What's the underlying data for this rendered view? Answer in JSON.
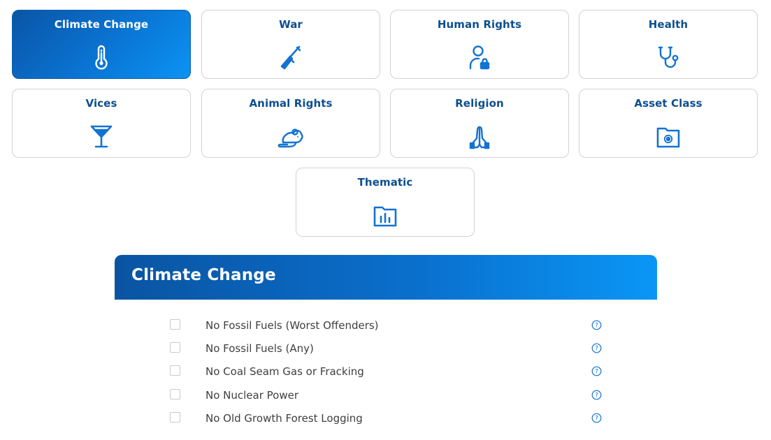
{
  "categories": [
    {
      "label": "Climate Change",
      "icon": "thermometer-icon",
      "active": true
    },
    {
      "label": "War",
      "icon": "rifle-icon",
      "active": false
    },
    {
      "label": "Human Rights",
      "icon": "person-lock-icon",
      "active": false
    },
    {
      "label": "Health",
      "icon": "stethoscope-icon",
      "active": false
    },
    {
      "label": "Vices",
      "icon": "cocktail-glass-icon",
      "active": false
    },
    {
      "label": "Animal Rights",
      "icon": "mouse-icon",
      "active": false
    },
    {
      "label": "Religion",
      "icon": "praying-hands-icon",
      "active": false
    },
    {
      "label": "Asset Class",
      "icon": "folder-gear-icon",
      "active": false
    },
    {
      "label": "Thematic",
      "icon": "folder-chart-icon",
      "active": false
    }
  ],
  "section": {
    "title": "Climate Change",
    "options": [
      {
        "label": "No Fossil Fuels (Worst Offenders)",
        "checked": false
      },
      {
        "label": "No Fossil Fuels (Any)",
        "checked": false
      },
      {
        "label": "No Coal Seam Gas or Fracking",
        "checked": false
      },
      {
        "label": "No Nuclear Power",
        "checked": false
      },
      {
        "label": "No Old Growth Forest Logging",
        "checked": false
      }
    ]
  },
  "colors": {
    "brand_blue": "#0a6fcc",
    "label_blue": "#0d4f8f",
    "icon_blue": "#1273d1"
  }
}
